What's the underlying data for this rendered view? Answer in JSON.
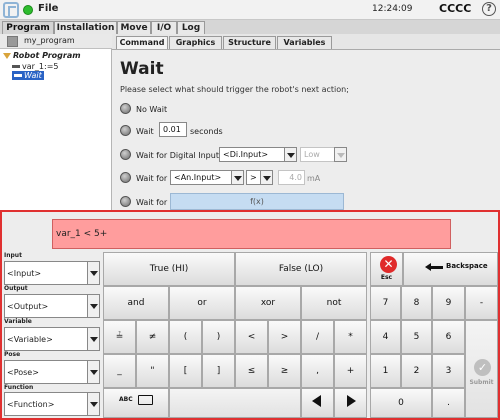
{
  "topbar": {
    "file_label": "File",
    "time": "12:24:09",
    "robot_name": "CCCC",
    "help_symbol": "?"
  },
  "main_tabs": [
    "Program",
    "Installation",
    "Move",
    "I/O",
    "Log"
  ],
  "active_main_tab": "Program",
  "program": {
    "name": "my_program",
    "tree": {
      "root": "Robot Program",
      "items": [
        "var_1:=5",
        "Wait"
      ]
    }
  },
  "command_tabs": [
    "Command",
    "Graphics",
    "Structure",
    "Variables"
  ],
  "command": {
    "title": "Wait",
    "instruction": "Please select what should trigger the robot's next action;",
    "options": {
      "no_wait": "No Wait",
      "wait_label": "Wait",
      "wait_value": "0.01",
      "wait_unit": "seconds",
      "digital_label": "Wait for Digital Input",
      "digital_input": "<Di.Input>",
      "digital_state": "Low",
      "analog_label": "Wait for",
      "analog_input": "<An.Input>",
      "analog_compare": ">",
      "analog_value": "4.0",
      "analog_unit": "mA",
      "expr_label": "Wait for",
      "expr_placeholder": "f(x)"
    }
  },
  "keypad": {
    "expression": "var_1 < 5+",
    "side": {
      "input_label": "Input",
      "input_value": "<Input>",
      "output_label": "Output",
      "output_value": "<Output>",
      "variable_label": "Variable",
      "variable_value": "<Variable>",
      "pose_label": "Pose",
      "pose_value": "<Pose>",
      "function_label": "Function",
      "function_value": "<Function>"
    },
    "bool_keys": [
      "True (HI)",
      "False (LO)"
    ],
    "logic_keys": [
      "and",
      "or",
      "xor",
      "not"
    ],
    "op_row1": [
      "≟",
      "≠",
      "(",
      ")",
      "<",
      ">",
      "/",
      "*"
    ],
    "op_row2": [
      "_",
      "\"",
      "[",
      "]",
      "≤",
      "≥",
      ",",
      "+"
    ],
    "abc_label": "ABC",
    "esc_label": "Esc",
    "backspace_label": "Backspace",
    "num_row1": [
      "7",
      "8",
      "9",
      "-"
    ],
    "num_row2": [
      "4",
      "5",
      "6"
    ],
    "num_row3": [
      "1",
      "2",
      "3"
    ],
    "num_row4": [
      "0",
      "."
    ],
    "submit_label": "Submit"
  },
  "colors": {
    "highlight_border": "#e03030",
    "expression_bg": "#ff9d9d",
    "selected_tree": "#2a63c5",
    "status_ok": "#2ebd2e"
  }
}
